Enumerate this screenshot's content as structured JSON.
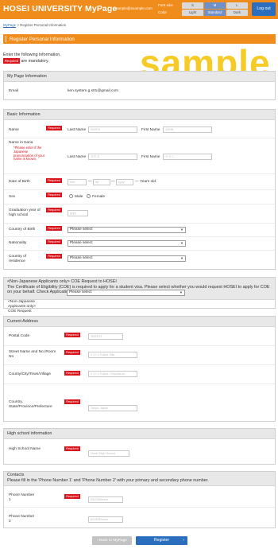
{
  "header": {
    "title": "HOSEI UNIVERSITY MyPage",
    "email": "sample@example.com",
    "font_size_label": "Font size",
    "color_label": "Color",
    "font_sizes": [
      "S",
      "M",
      "L"
    ],
    "colors": [
      "Light",
      "Standard",
      "Dark"
    ],
    "logout": "Log out"
  },
  "breadcrumb": {
    "home": "MyPage",
    "sep": ">",
    "current": "Register Personal Information"
  },
  "page_title": "Register Personal Information",
  "intro": {
    "line1": "Enter the following information.",
    "required_badge": "Required",
    "line2_suffix": " are mandatory."
  },
  "watermark": "sample",
  "mypage": {
    "heading": "My Page Information",
    "email_label": "Email",
    "email_value": "ken.system.g.s01@gmail.com"
  },
  "basic": {
    "heading": "Basic Information",
    "required": "Required",
    "name_label": "Name",
    "last_name": "Last Name",
    "first_name": "First Name",
    "last_ph": "SMITH",
    "first_ph": "JOHN",
    "kana_label": "Name in Kana",
    "kana_note": "*Please enter if the Japanese pronunciation of your name is known.",
    "kana_last_ph": "スミス",
    "kana_first_ph": "ジョン",
    "dob_label": "Date of Birth",
    "dob_mm": "mm",
    "dob_dd": "dd",
    "dob_yyyy": "yyyy",
    "dob_sep": "—",
    "years_old": "— Years old",
    "sex_label": "Sex",
    "male": "Male",
    "female": "Female",
    "grad_label": "Graduation year of high school",
    "grad_ph": "yyyy",
    "cob_label": "Country of Birth",
    "nat_label": "Nationality",
    "cor_label": "Country of residence",
    "select_ph": "Please select"
  },
  "coe": {
    "heading_line1": "<Non-Japanese Applicants only> COE Request to HOSEI",
    "heading_line2": "The Certificate of Eligibility (COE) is required to apply for a student visa. Please select whether you would request HOSEI to apply for COE on your behalf. Check Application Guidelines for the details about COE.",
    "label": "<Non-Japanese Applicants only> COE Request",
    "select_ph": "Please select"
  },
  "address": {
    "heading": "Current Address",
    "required": "Required",
    "postal_label": "Postal Code",
    "postal_ph": "1020071",
    "street_label": "Street Name and No./Room No",
    "street_ph": "2-17-1 Fujimi Hills",
    "city_label": "County/City/Town/Village",
    "city_ph": "2-17-1 Fujimi, Chiyoda-ku",
    "state_label": "Country, State/Province/Prefecture",
    "state_ph": "Tokyo, Japan"
  },
  "highschool": {
    "heading": "High school information",
    "required": "Required",
    "label": "High School Name",
    "ph": "Hosei High School"
  },
  "contacts": {
    "heading": "Contacts",
    "sub": "Please fill in the 'Phone Number 1' and 'Phone Number 2' with your primary and secondary phone number.",
    "required": "Required",
    "phone1_label": "Phone Number 1",
    "phone1_ph": "0312345xxxx",
    "phone2_label": "Phone Number 2",
    "phone2_ph": "8113330xxxx"
  },
  "buttons": {
    "back": "‹ Back to MyPage",
    "register": "Register",
    "register_arrow": "›"
  }
}
